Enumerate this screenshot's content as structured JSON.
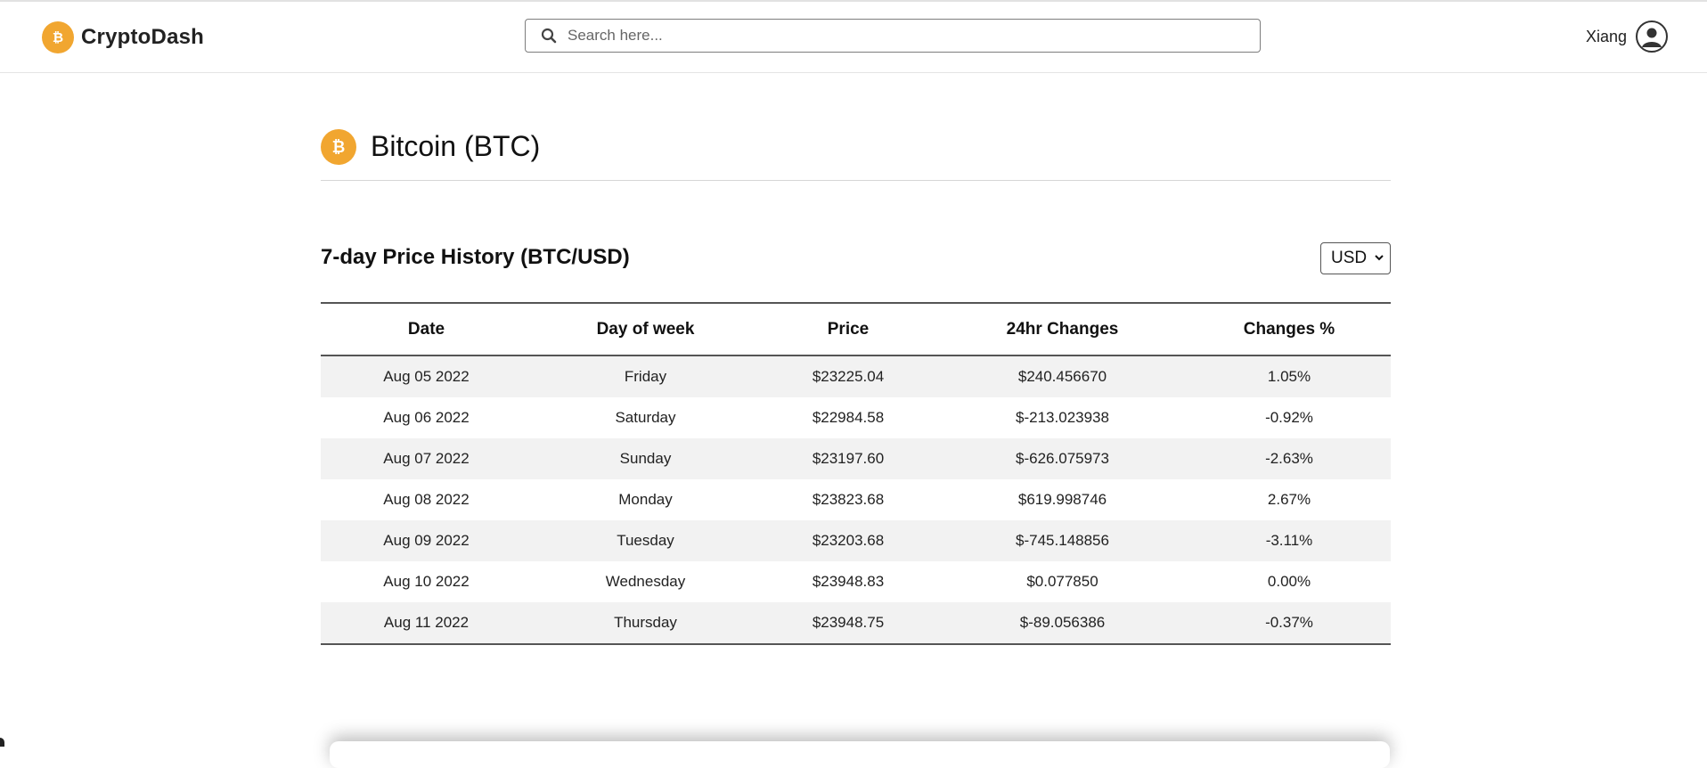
{
  "brand": {
    "name": "CryptoDash",
    "icon": "bitcoin-icon",
    "color": "#f1a630"
  },
  "search": {
    "placeholder": "Search here...",
    "value": ""
  },
  "user": {
    "name": "Xiang",
    "icon": "user-avatar-icon"
  },
  "coin": {
    "title": "Bitcoin (BTC)",
    "icon": "bitcoin-icon"
  },
  "history": {
    "title": "7-day Price History (BTC/USD)",
    "currency": "USD",
    "columns": [
      "Date",
      "Day of week",
      "Price",
      "24hr Changes",
      "Changes %"
    ],
    "rows": [
      {
        "date": "Aug 05 2022",
        "day": "Friday",
        "price": "$23225.04",
        "change": "$240.456670",
        "pct": "1.05%",
        "trend": "up"
      },
      {
        "date": "Aug 06 2022",
        "day": "Saturday",
        "price": "$22984.58",
        "change": "$-213.023938",
        "pct": "-0.92%",
        "trend": "down"
      },
      {
        "date": "Aug 07 2022",
        "day": "Sunday",
        "price": "$23197.60",
        "change": "$-626.075973",
        "pct": "-2.63%",
        "trend": "down"
      },
      {
        "date": "Aug 08 2022",
        "day": "Monday",
        "price": "$23823.68",
        "change": "$619.998746",
        "pct": "2.67%",
        "trend": "up"
      },
      {
        "date": "Aug 09 2022",
        "day": "Tuesday",
        "price": "$23203.68",
        "change": "$-745.148856",
        "pct": "-3.11%",
        "trend": "down"
      },
      {
        "date": "Aug 10 2022",
        "day": "Wednesday",
        "price": "$23948.83",
        "change": "$0.077850",
        "pct": "0.00%",
        "trend": "up"
      },
      {
        "date": "Aug 11 2022",
        "day": "Thursday",
        "price": "$23948.75",
        "change": "$-89.056386",
        "pct": "-0.37%",
        "trend": "down"
      }
    ]
  },
  "colors": {
    "up": "#2e8b4a",
    "down": "#d1323a",
    "accent": "#f1a630"
  }
}
